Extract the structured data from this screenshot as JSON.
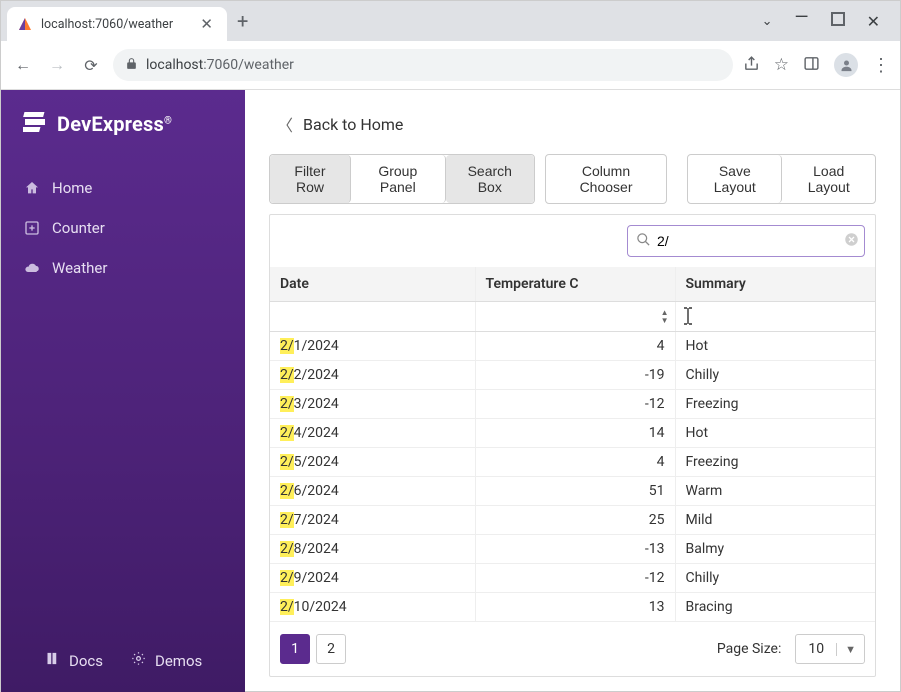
{
  "browser": {
    "tab_title": "localhost:7060/weather",
    "url_display": "localhost:7060/weather",
    "url_host": "localhost",
    "url_port_path": ":7060/weather"
  },
  "brand": {
    "name": "DevExpress",
    "reg": "®"
  },
  "sidebar": {
    "items": [
      {
        "label": "Home",
        "icon": "home-icon"
      },
      {
        "label": "Counter",
        "icon": "plus-box-icon"
      },
      {
        "label": "Weather",
        "icon": "cloud-icon"
      }
    ],
    "footer": {
      "docs": "Docs",
      "demos": "Demos"
    }
  },
  "back_link": "Back to Home",
  "toolbar": {
    "filter_row": "Filter Row",
    "group_panel": "Group Panel",
    "search_box": "Search Box",
    "column_chooser": "Column Chooser",
    "save_layout": "Save Layout",
    "load_layout": "Load Layout"
  },
  "search": {
    "value": "2/",
    "highlight": "2/"
  },
  "columns": {
    "date": "Date",
    "temp": "Temperature C",
    "summary": "Summary"
  },
  "rows": [
    {
      "date_hl": "2/",
      "date_rest": "1/2024",
      "temp": "4",
      "summary": "Hot"
    },
    {
      "date_hl": "2/",
      "date_rest": "2/2024",
      "temp": "-19",
      "summary": "Chilly"
    },
    {
      "date_hl": "2/",
      "date_rest": "3/2024",
      "temp": "-12",
      "summary": "Freezing"
    },
    {
      "date_hl": "2/",
      "date_rest": "4/2024",
      "temp": "14",
      "summary": "Hot"
    },
    {
      "date_hl": "2/",
      "date_rest": "5/2024",
      "temp": "4",
      "summary": "Freezing"
    },
    {
      "date_hl": "2/",
      "date_rest": "6/2024",
      "temp": "51",
      "summary": "Warm"
    },
    {
      "date_hl": "2/",
      "date_rest": "7/2024",
      "temp": "25",
      "summary": "Mild"
    },
    {
      "date_hl": "2/",
      "date_rest": "8/2024",
      "temp": "-13",
      "summary": "Balmy"
    },
    {
      "date_hl": "2/",
      "date_rest": "9/2024",
      "temp": "-12",
      "summary": "Chilly"
    },
    {
      "date_hl": "2/",
      "date_rest": "10/2024",
      "temp": "13",
      "summary": "Bracing"
    }
  ],
  "pager": {
    "pages": [
      "1",
      "2"
    ],
    "active_page": "1",
    "page_size_label": "Page Size:",
    "page_size_value": "10"
  },
  "chart_data": {
    "type": "table",
    "title": "Weather",
    "columns": [
      "Date",
      "Temperature C",
      "Summary"
    ],
    "rows": [
      [
        "2/1/2024",
        4,
        "Hot"
      ],
      [
        "2/2/2024",
        -19,
        "Chilly"
      ],
      [
        "2/3/2024",
        -12,
        "Freezing"
      ],
      [
        "2/4/2024",
        14,
        "Hot"
      ],
      [
        "2/5/2024",
        4,
        "Freezing"
      ],
      [
        "2/6/2024",
        51,
        "Warm"
      ],
      [
        "2/7/2024",
        25,
        "Mild"
      ],
      [
        "2/8/2024",
        -13,
        "Balmy"
      ],
      [
        "2/9/2024",
        -12,
        "Chilly"
      ],
      [
        "2/10/2024",
        13,
        "Bracing"
      ]
    ]
  }
}
